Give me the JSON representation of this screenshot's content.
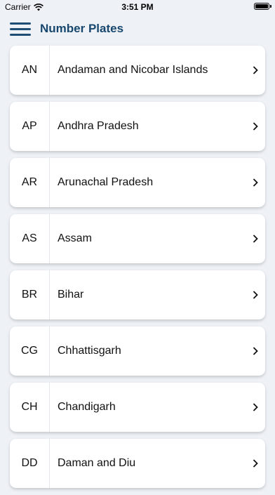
{
  "status": {
    "carrier": "Carrier",
    "time": "3:51 PM"
  },
  "header": {
    "title": "Number Plates"
  },
  "states": [
    {
      "code": "AN",
      "name": "Andaman and Nicobar Islands"
    },
    {
      "code": "AP",
      "name": "Andhra Pradesh"
    },
    {
      "code": "AR",
      "name": "Arunachal Pradesh"
    },
    {
      "code": "AS",
      "name": "Assam"
    },
    {
      "code": "BR",
      "name": "Bihar"
    },
    {
      "code": "CG",
      "name": "Chhattisgarh"
    },
    {
      "code": "CH",
      "name": "Chandigarh"
    },
    {
      "code": "DD",
      "name": "Daman and Diu"
    }
  ]
}
